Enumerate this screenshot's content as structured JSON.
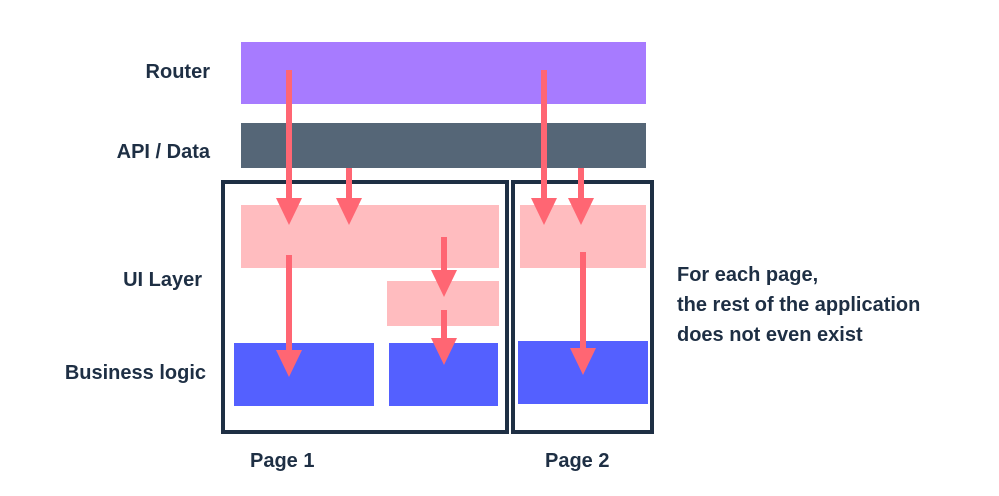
{
  "diagram": {
    "layers": {
      "router": "Router",
      "api": "API / Data",
      "ui": "UI Layer",
      "business": "Business logic"
    },
    "pages": {
      "page1": "Page 1",
      "page2": "Page 2"
    },
    "note": {
      "line1": "For each page,",
      "line2": "the rest of the application",
      "line3": "does not even exist"
    },
    "colors": {
      "router": "#a77bff",
      "api": "#556677",
      "ui": "#ffbcbf",
      "business": "#5460ff",
      "arrow": "#ff6673",
      "frame": "#1e2f44",
      "text": "#1e2f44"
    }
  }
}
